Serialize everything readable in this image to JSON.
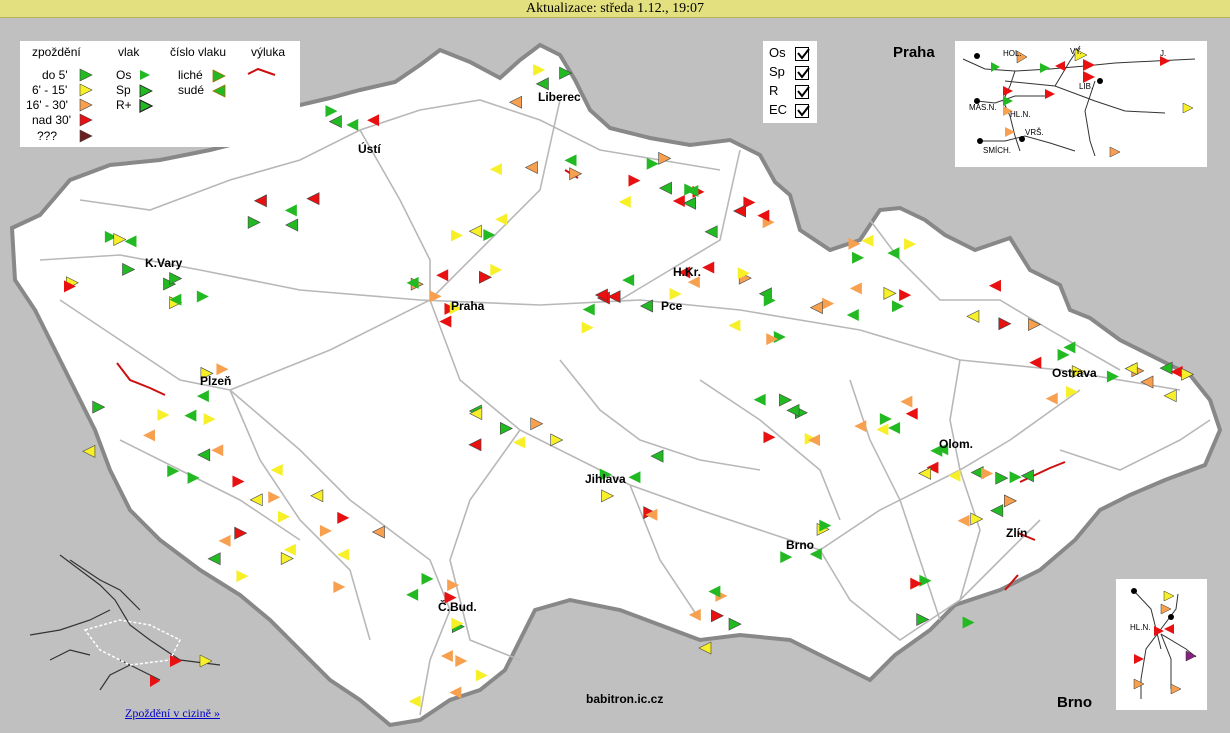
{
  "header": {
    "title": "Aktualizace: středa 1.12., 19:07"
  },
  "legend": {
    "delay_title": "zpoždění",
    "train_title": "vlak",
    "number_title": "číslo vlaku",
    "closure_title": "výluka",
    "delays": [
      {
        "label": "do 5'",
        "color": "#22b922"
      },
      {
        "label": "6' - 15'",
        "color": "#f7ef28"
      },
      {
        "label": "16' - 30'",
        "color": "#f7a050"
      },
      {
        "label": "nad 30'",
        "color": "#e81010"
      },
      {
        "label": "???",
        "color": "#6b2020"
      }
    ],
    "trains": [
      {
        "label": "Os"
      },
      {
        "label": "Sp"
      },
      {
        "label": "R+"
      }
    ],
    "numbers": [
      {
        "label": "liché"
      },
      {
        "label": "sudé"
      }
    ]
  },
  "filters": [
    {
      "label": "Os",
      "checked": true
    },
    {
      "label": "Sp",
      "checked": true
    },
    {
      "label": "R",
      "checked": true
    },
    {
      "label": "EC",
      "checked": true
    }
  ],
  "cities": [
    {
      "name": "Ústí",
      "id": "usti"
    },
    {
      "name": "Liberec",
      "id": "liberec"
    },
    {
      "name": "K.Vary",
      "id": "kvary"
    },
    {
      "name": "Praha",
      "id": "praha"
    },
    {
      "name": "H.Kr.",
      "id": "hkr"
    },
    {
      "name": "Pce",
      "id": "pce"
    },
    {
      "name": "Plzeň",
      "id": "plzen"
    },
    {
      "name": "Ostrava",
      "id": "ostrava"
    },
    {
      "name": "Olom.",
      "id": "olom"
    },
    {
      "name": "Jihlava",
      "id": "jihlava"
    },
    {
      "name": "Brno",
      "id": "brno"
    },
    {
      "name": "Zlín",
      "id": "zlin"
    },
    {
      "name": "Č.Bud.",
      "id": "cbud"
    }
  ],
  "insets": {
    "praha_title": "Praha",
    "brno_title": "Brno",
    "praha_labels": [
      "HOL.",
      "VY.",
      "J.",
      "LIB.",
      "MAS.N.",
      "HL.N.",
      "VRŠ.",
      "SMÍCH."
    ],
    "brno_labels": [
      "HL.N."
    ]
  },
  "footer": {
    "site": "babitron.ic.cz",
    "abroad_link": "Zpoždění v cizině »"
  }
}
